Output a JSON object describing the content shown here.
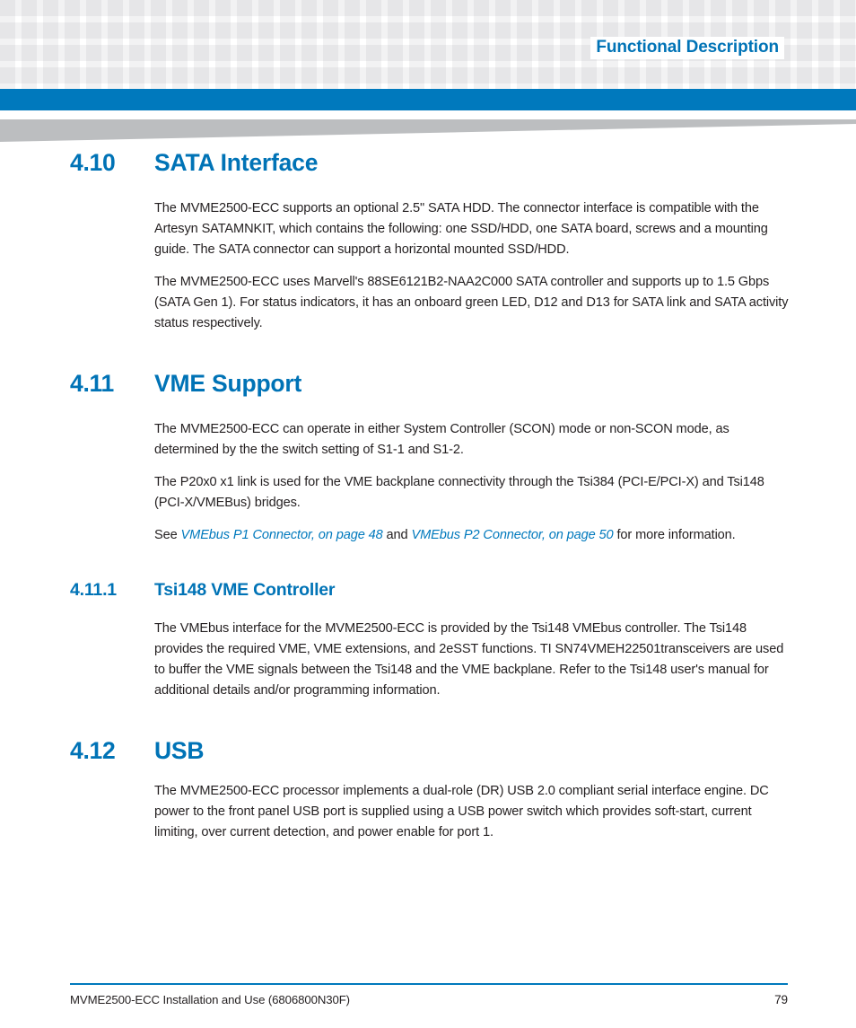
{
  "header": {
    "running_title": "Functional Description",
    "accent_color": "#0079bd",
    "title_color": "#0073b6",
    "grid_color": "#f2f2f3",
    "wedge_color": "#bcbec0"
  },
  "sections": [
    {
      "number": "4.10",
      "title": "SATA Interface",
      "level": 1,
      "paragraphs": [
        "The MVME2500-ECC supports an optional 2.5\" SATA HDD. The connector interface is compatible with the Artesyn SATAMNKIT, which contains the following: one SSD/HDD, one SATA board, screws and a mounting guide.  The SATA connector can support a horizontal mounted SSD/HDD.",
        "The MVME2500-ECC uses Marvell's 88SE6121B2-NAA2C000 SATA controller and supports up to 1.5 Gbps (SATA Gen 1). For status indicators, it has an onboard green LED, D12 and D13 for SATA link and SATA activity status respectively."
      ]
    },
    {
      "number": "4.11",
      "title": "VME Support",
      "level": 1,
      "paragraphs": [
        "The MVME2500-ECC  can operate in either System Controller (SCON) mode or non-SCON mode, as determined by the the switch setting of S1-1 and S1-2.",
        "The P20x0 x1 link is used for the VME backplane connectivity through the Tsi384 (PCI-E/PCI-X) and Tsi148 (PCI-X/VMEBus) bridges."
      ],
      "xref_paragraph": {
        "lead": "See ",
        "link1": "VMEbus P1 Connector, on page 48",
        "middle": " and ",
        "link2": "VMEbus P2 Connector, on page 50",
        "tail": " for more information."
      }
    },
    {
      "number": "4.11.1",
      "title": "Tsi148 VME Controller",
      "level": 2,
      "paragraphs": [
        "The VMEbus interface for the MVME2500-ECC is provided by the Tsi148 VMEbus controller. The Tsi148 provides the required VME, VME extensions, and 2eSST functions. TI SN74VMEH22501transceivers are used to buffer the VME signals between the Tsi148 and the VME backplane. Refer to the Tsi148 user's manual for additional details and/or programming information."
      ]
    },
    {
      "number": "4.12",
      "title": "USB",
      "level": 1,
      "paragraphs": [
        "The MVME2500-ECC processor implements a dual-role (DR) USB 2.0 compliant serial interface engine. DC power to the front panel USB port is supplied using a USB power switch which provides soft-start, current limiting, over current detection, and power enable for port 1."
      ]
    }
  ],
  "footer": {
    "document_title": "MVME2500-ECC Installation and Use (6806800N30F)",
    "page_number": "79"
  }
}
